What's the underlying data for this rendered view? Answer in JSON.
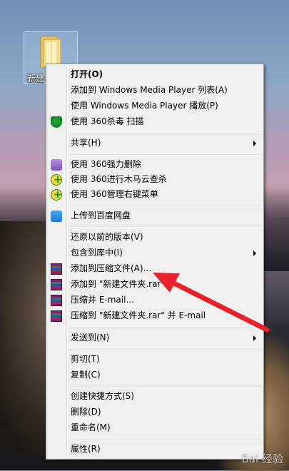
{
  "desktop": {
    "icon_label": "新建",
    "watermark": "Bai 经验"
  },
  "menu": {
    "items": [
      {
        "label": "打开(O)",
        "bold": true
      },
      {
        "label": "添加到 Windows Media Player 列表(A)"
      },
      {
        "label": "使用 Windows Media Player 播放(P)"
      },
      {
        "label": "使用 360杀毒 扫描",
        "icon": "shield-icon"
      },
      {
        "label": "共享(H)",
        "submenu": true
      },
      {
        "label": "使用 360强力删除",
        "icon": "shredder-icon"
      },
      {
        "label": "使用 360进行木马云查杀",
        "icon": "360-icon"
      },
      {
        "label": "使用 360管理右键菜单",
        "icon": "360-icon"
      },
      {
        "label": "上传到百度网盘",
        "icon": "baidu-cloud-icon"
      },
      {
        "label": "还原以前的版本(V)"
      },
      {
        "label": "包含到库中(I)",
        "submenu": true
      },
      {
        "label": "添加到压缩文件(A)...",
        "icon": "winrar-icon"
      },
      {
        "label": "添加到 \"新建文件夹.rar\"",
        "icon": "winrar-icon"
      },
      {
        "label": "压缩并 E-mail...",
        "icon": "winrar-icon"
      },
      {
        "label": "压缩到 \"新建文件夹.rar\" 并 E-mail",
        "icon": "winrar-icon"
      },
      {
        "label": "发送到(N)",
        "submenu": true
      },
      {
        "label": "剪切(T)"
      },
      {
        "label": "复制(C)"
      },
      {
        "label": "创建快捷方式(S)"
      },
      {
        "label": "删除(D)"
      },
      {
        "label": "重命名(M)"
      },
      {
        "label": "属性(R)"
      }
    ]
  },
  "annotation": {
    "color": "#e8222b"
  }
}
